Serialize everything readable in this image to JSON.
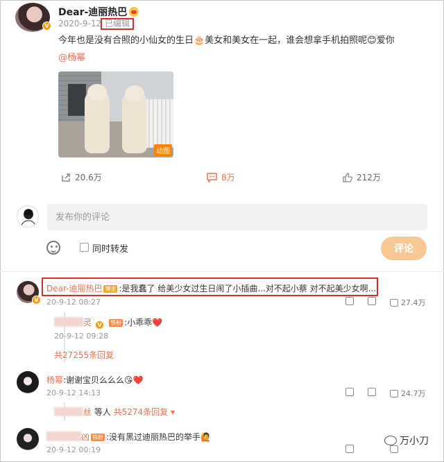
{
  "post": {
    "author": "Dear-迪丽热巴",
    "date": "2020-9-12",
    "edited_label": "已编辑",
    "text": "今年也是没有合照的小仙女的生日🎂美女和美女在一起，谁会想拿手机拍照呢😊爱你",
    "mention": "@杨幂",
    "media_badge": "动图",
    "stats": {
      "repost": "20.6万",
      "comment": "8万",
      "like": "212万"
    }
  },
  "composer": {
    "placeholder": "发布你的评论",
    "repost_label": "同时转发",
    "submit_label": "评论"
  },
  "comments": [
    {
      "author": "Dear-迪丽热巴",
      "tag": "博主",
      "text": ":是我蠢了 给美少女过生日闹了小插曲...对不起小蔡 对不起美少女啊...",
      "date": "20-9-12 08:27",
      "likes": "27.4万",
      "reply": {
        "author_suffix": "灵",
        "tag": "铁粉",
        "text": ":小乖乖❤️",
        "date": "20-9-12 09:28"
      },
      "more_replies": "共27255条回复"
    },
    {
      "author": "杨幂",
      "text": ":谢谢宝贝么么么😘❤️",
      "date": "20-9-12 14:13",
      "likes": "24.7万",
      "reply_summary_prefix": "丝",
      "reply_summary_mid": " 等人 ",
      "more_replies": "共5274条回复"
    },
    {
      "author_suffix": "凶",
      "tag": "铁粉",
      "text": ":没有黑过迪丽热巴的举手🙋",
      "date": "20-9-12 00:19"
    }
  ],
  "watermark": "万小刀",
  "colors": {
    "accent": "#eb7350",
    "highlight_box": "#d32f2f",
    "submit_bg": "#f7c794"
  }
}
